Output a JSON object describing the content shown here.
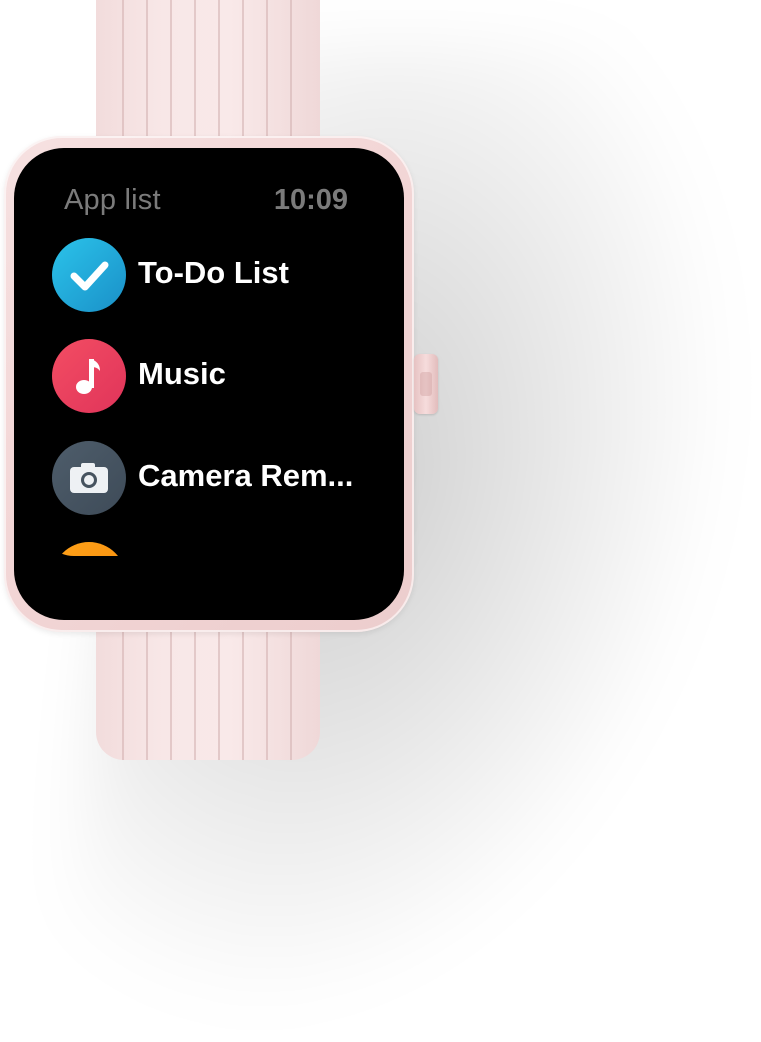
{
  "screen": {
    "title": "App list",
    "time": "10:09"
  },
  "apps": [
    {
      "label": "To-Do List",
      "icon": "checkmark-icon",
      "color": "#1da6d8"
    },
    {
      "label": "Music",
      "icon": "music-note-icon",
      "color": "#ea3f5e"
    },
    {
      "label": "Camera Rem...",
      "icon": "camera-icon",
      "color": "#46535f"
    },
    {
      "label": "",
      "icon": "partial-app-icon",
      "color": "#f8960f"
    }
  ],
  "device": {
    "strap_color": "#f6e3e3",
    "case_color": "#f3d7d7",
    "bezel_color": "#000000"
  }
}
